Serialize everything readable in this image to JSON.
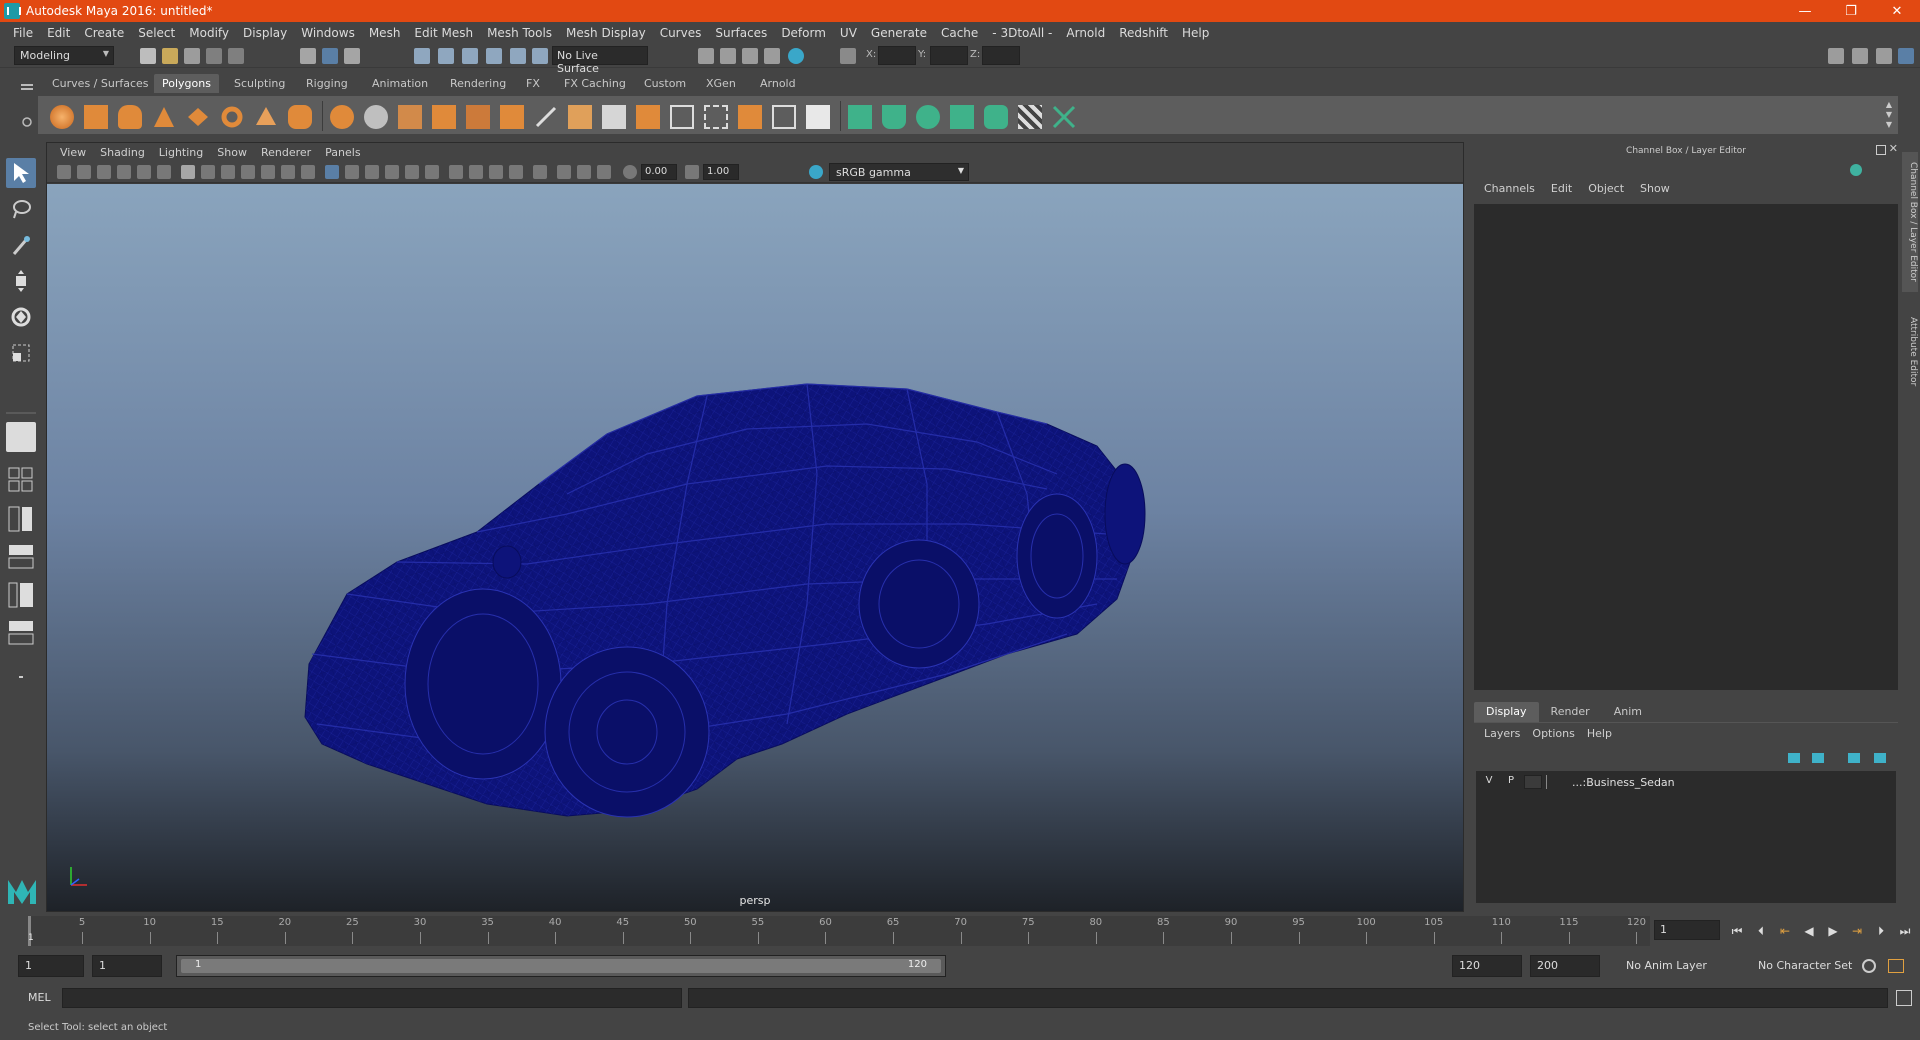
{
  "window": {
    "title": "Autodesk Maya 2016: untitled*",
    "minimize": "—",
    "maximize": "❐",
    "close": "✕"
  },
  "menubar": [
    "File",
    "Edit",
    "Create",
    "Select",
    "Modify",
    "Display",
    "Windows",
    "Mesh",
    "Edit Mesh",
    "Mesh Tools",
    "Mesh Display",
    "Curves",
    "Surfaces",
    "Deform",
    "UV",
    "Generate",
    "Cache",
    "- 3DtoAll -",
    "Arnold",
    "Redshift",
    "Help"
  ],
  "status_line": {
    "mode": "Modeling",
    "live_surface": "No Live Surface",
    "x_label": "X:",
    "y_label": "Y:",
    "z_label": "Z:"
  },
  "shelf_tabs": [
    "Curves / Surfaces",
    "Polygons",
    "Sculpting",
    "Rigging",
    "Animation",
    "Rendering",
    "FX",
    "FX Caching",
    "Custom",
    "XGen",
    "Arnold"
  ],
  "active_shelf": "Polygons",
  "panel": {
    "menu": [
      "View",
      "Shading",
      "Lighting",
      "Show",
      "Renderer",
      "Panels"
    ],
    "exposure": "0.00",
    "gamma": "1.00",
    "color_space": "sRGB gamma",
    "camera": "persp"
  },
  "channel_box": {
    "header": "Channel Box / Layer Editor",
    "menu": [
      "Channels",
      "Edit",
      "Object",
      "Show"
    ]
  },
  "layer_editor": {
    "tabs": [
      "Display",
      "Render",
      "Anim"
    ],
    "active_tab": "Display",
    "menu": [
      "Layers",
      "Options",
      "Help"
    ],
    "layers": [
      {
        "v": "V",
        "p": "P",
        "name": "...:Business_Sedan"
      }
    ]
  },
  "side_tabs": [
    "Channel Box / Layer Editor",
    "Attribute Editor"
  ],
  "timeline": {
    "ticks": [
      "5",
      "10",
      "15",
      "20",
      "25",
      "30",
      "35",
      "40",
      "45",
      "50",
      "55",
      "60",
      "65",
      "70",
      "75",
      "80",
      "85",
      "90",
      "95",
      "100",
      "105",
      "110",
      "115",
      "120"
    ],
    "current_frame_label": "1",
    "current_frame": "1"
  },
  "range": {
    "start": "1",
    "playback_start": "1",
    "slider_start": "1",
    "slider_end": "120",
    "playback_end": "120",
    "end": "200",
    "anim_layer": "No Anim Layer",
    "character_set": "No Character Set"
  },
  "command_line": {
    "label": "MEL"
  },
  "help_line": "Select Tool: select an object",
  "colors": {
    "titlebar": "#e24912",
    "wireframe": "#0c1078",
    "ui_bg": "#444444",
    "shelf_bg": "#5d5d5d",
    "active_tool": "#5a7fa6"
  }
}
